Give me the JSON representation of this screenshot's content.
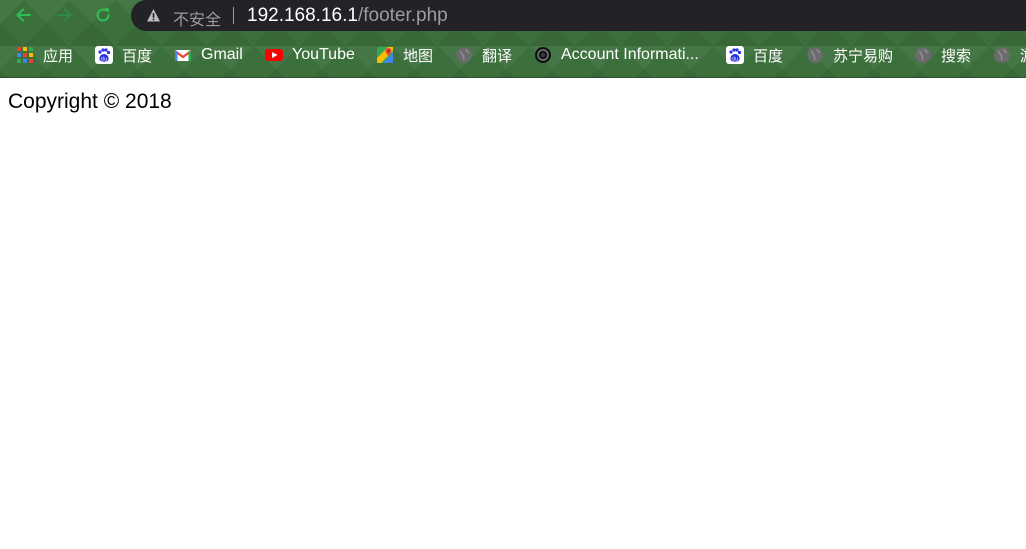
{
  "browser": {
    "security_label": "不安全",
    "url_host": "192.168.16.1",
    "url_path": "/footer.php",
    "colors": {
      "nav_accent": "#2fbf52",
      "omnibox_bg": "#232227",
      "theme_green": "#3b6f3c"
    },
    "bookmarks": [
      {
        "label": "应用",
        "icon": "apps-grid-icon"
      },
      {
        "label": "百度",
        "icon": "baidu-icon"
      },
      {
        "label": "Gmail",
        "icon": "gmail-icon"
      },
      {
        "label": "YouTube",
        "icon": "youtube-icon"
      },
      {
        "label": "地图",
        "icon": "maps-icon"
      },
      {
        "label": "翻译",
        "icon": "globe-icon"
      },
      {
        "label": "Account Informati...",
        "icon": "account-icon"
      },
      {
        "label": "百度",
        "icon": "baidu-icon"
      },
      {
        "label": "苏宁易购",
        "icon": "globe-icon"
      },
      {
        "label": "搜索",
        "icon": "globe-icon"
      },
      {
        "label": "游",
        "icon": "globe-icon"
      }
    ]
  },
  "page": {
    "footer_text": "Copyright © 2018"
  }
}
